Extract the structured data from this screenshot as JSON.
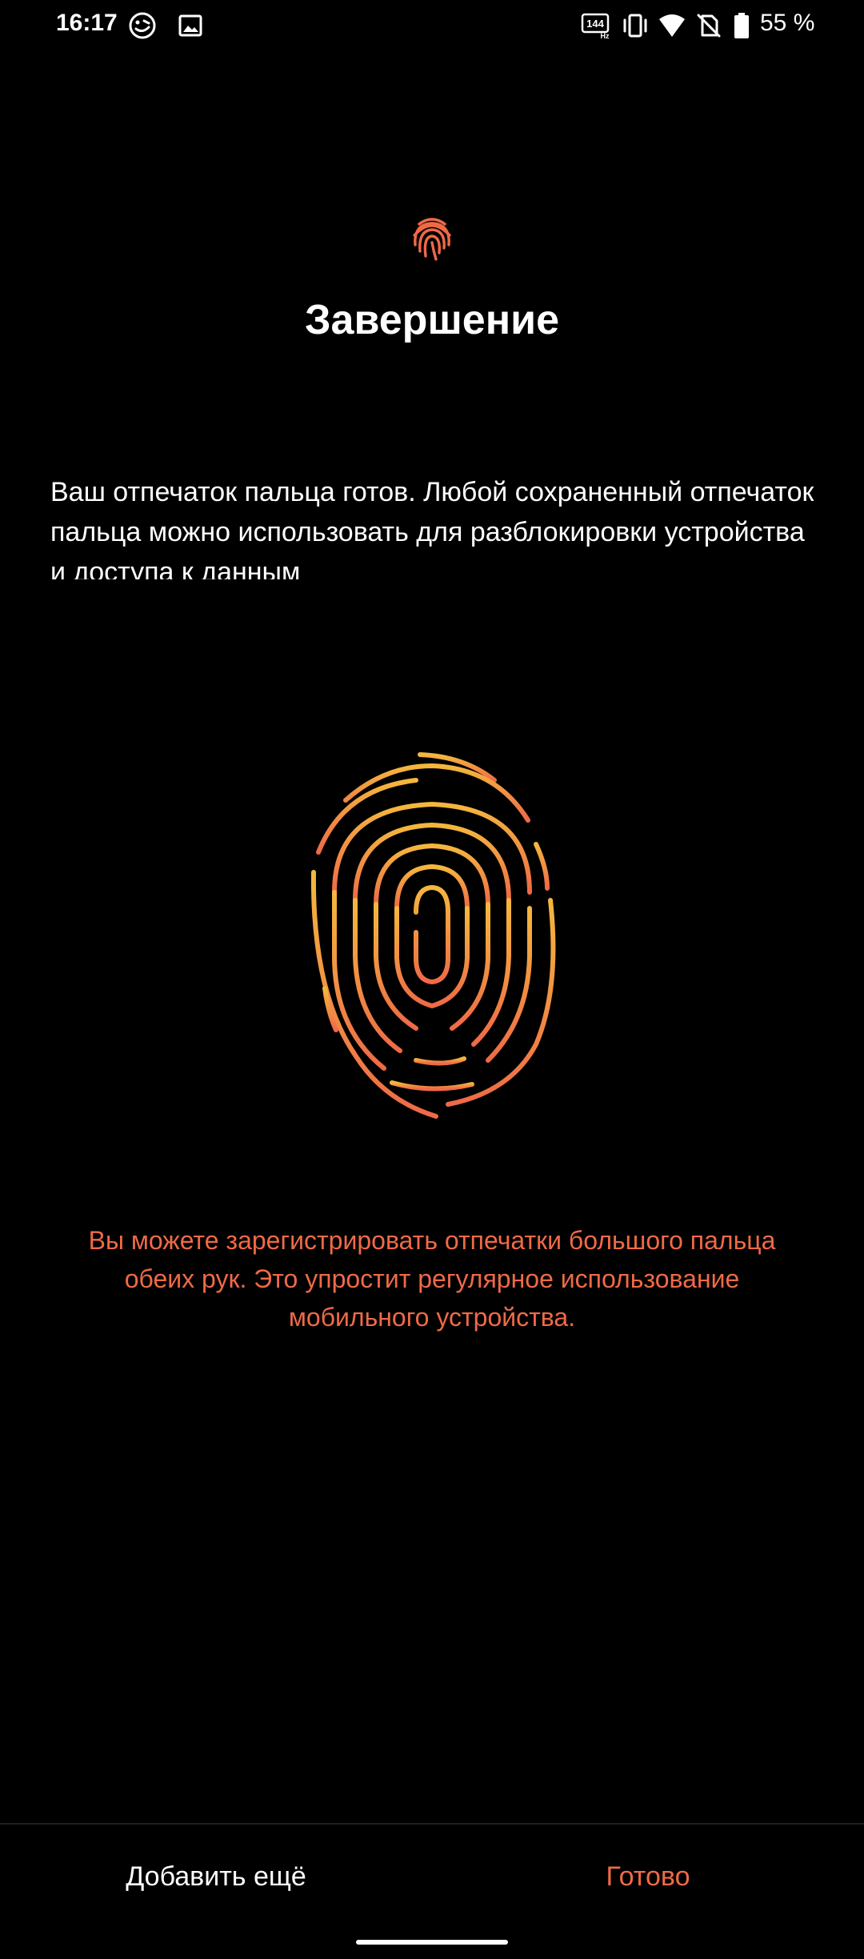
{
  "status_bar": {
    "time": "16:17",
    "battery_text": "55 %",
    "left_icons": [
      "asus-smiley-icon",
      "image-icon"
    ],
    "right_icons": [
      "refresh-rate-144hz-icon",
      "vibrate-icon",
      "wifi-icon",
      "no-sim-icon",
      "battery-icon"
    ],
    "refresh_rate_label": "144",
    "refresh_rate_unit": "Hz"
  },
  "header": {
    "icon": "fingerprint-icon",
    "title": "Завершение"
  },
  "description": "Ваш отпечаток пальца готов. Любой сохраненный отпечаток пальца можно использовать для разблокировки устройства и доступа к данным",
  "illustration": {
    "icon": "fingerprint-illustration",
    "gradient_top": "#f4b73e",
    "gradient_bottom": "#ef6a47"
  },
  "hint": "Вы можете зарегистрировать отпечатки большого пальца обеих рук. Это упростит регулярное использование мобильного устройства.",
  "buttons": {
    "add_more": "Добавить ещё",
    "done": "Готово"
  },
  "colors": {
    "background": "#000000",
    "accent": "#ef6a47",
    "text": "#ffffff"
  }
}
